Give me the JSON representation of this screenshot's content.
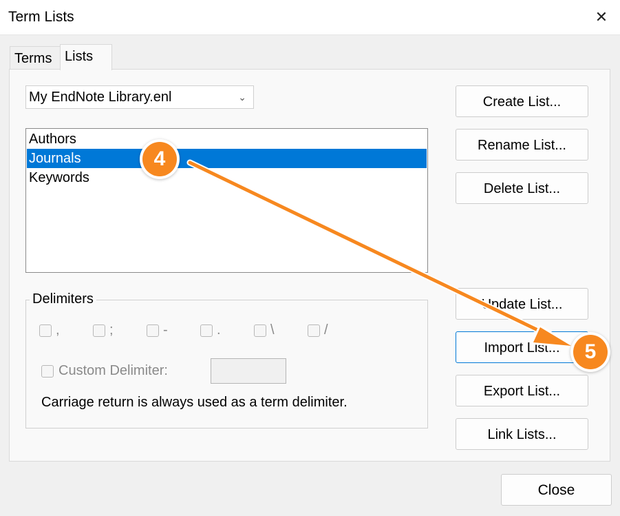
{
  "window": {
    "title": "Term Lists",
    "close_icon": "close-icon"
  },
  "tabs": [
    {
      "label": "Terms",
      "active": false
    },
    {
      "label": "Lists",
      "active": true
    }
  ],
  "library_select": {
    "value": "My EndNote Library.enl"
  },
  "lists": {
    "items": [
      {
        "label": "Authors",
        "selected": false
      },
      {
        "label": "Journals",
        "selected": true
      },
      {
        "label": "Keywords",
        "selected": false
      }
    ]
  },
  "buttons": {
    "create": "Create List...",
    "rename": "Rename List...",
    "delete": "Delete List...",
    "update": "Update List...",
    "import": "Import List...",
    "export": "Export List...",
    "link": "Link Lists...",
    "close": "Close"
  },
  "delimiters": {
    "legend": "Delimiters",
    "options": [
      ",",
      ";",
      "-",
      ".",
      "\\",
      "/"
    ],
    "custom_label": "Custom Delimiter:",
    "custom_value": "",
    "note": "Carriage return is always used as a term delimiter."
  },
  "annotations": {
    "step4": "4",
    "step5": "5",
    "color": "#f7881f"
  },
  "colors": {
    "selection": "#0078d7",
    "accent": "#f7881f"
  }
}
